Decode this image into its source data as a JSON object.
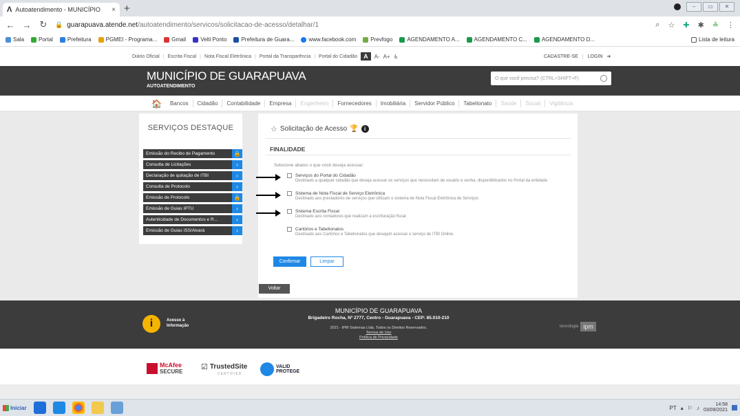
{
  "browser": {
    "tab_title": "Autoatendimento - MUNICÍPIO",
    "tab_close": "×",
    "new_tab": "+",
    "url_host": "guarapuava.atende.net",
    "url_path": "/autoatendimento/servicos/solicitacao-de-acesso/detalhar/1",
    "bookmarks": [
      "Sala",
      "Portal",
      "Prefeitura",
      "PGMEI - Programa...",
      "Gmail",
      "Velti Ponto",
      "Prefeitura de Guara...",
      "www.facebook.com",
      "Prevfogo",
      "AGENDAMENTO A...",
      "AGENDAMENTO C...",
      "AGENDAMENTO D..."
    ],
    "reading_list": "Lista de leitura"
  },
  "topstrip": {
    "links": [
      "Diário Oficial",
      "Escrita Fiscal",
      "Nota Fiscal Eletrônica",
      "Portal da Transparência",
      "Portal do Cidadão"
    ],
    "acc_a": "A",
    "acc_minus": "A-",
    "acc_plus": "A+",
    "register": "CADASTRE-SE",
    "login": "LOGIN"
  },
  "header": {
    "title": "MUNICÍPIO DE GUARAPUAVA",
    "subtitle": "AUTOATENDIMENTO",
    "search_placeholder": "O que você precisa? (CTRL+SHIFT+F)"
  },
  "menu": {
    "items": [
      "Bancos",
      "Cidadão",
      "Contabilidade",
      "Empresa",
      "Engenheiro",
      "Fornecedores",
      "Imobiliária",
      "Servidor Público",
      "Tabelionato",
      "Saúde",
      "Social",
      "Vigilância"
    ]
  },
  "sidebar": {
    "title": "SERVIÇOS DESTAQUE",
    "items": [
      {
        "label": "Emissão do Recibo de Pagamento"
      },
      {
        "label": "Consulta de Licitações"
      },
      {
        "label": "Declaração de quitação de ITBI"
      },
      {
        "label": "Consulta de Protocolo"
      },
      {
        "label": "Emissão de Protocolo"
      },
      {
        "label": "Emissão de Guias IPTU"
      },
      {
        "label": "Autenticidade de Documentos e R..."
      },
      {
        "label": "Emissão de Guias ISS/Alvará"
      }
    ]
  },
  "panel": {
    "title": "Solicitação de Acesso",
    "section": "FINALIDADE",
    "instruction": "Selecione abaixo o que você deseja acessar:",
    "options": [
      {
        "name": "Serviços do Portal do Cidadão",
        "desc": "Destinado a qualquer cidadão que deseja acessar os serviços que necessitam de usuário e senha, disponibilizados no Portal da entidade."
      },
      {
        "name": "Sistema de Nota Fiscal de Serviço Eletrônica",
        "desc": "Destinado aos prestadores de serviços que utilizam o sistema de Nota Fiscal Eletrônica de Serviços"
      },
      {
        "name": "Sistema Escrita Fiscal",
        "desc": "Destinado aos contadores que realizam a escrituração fiscal."
      },
      {
        "name": "Cartórios e Tabelionatos",
        "desc": "Destinado aos Cartórios e Tabelionatos que desejam acessar o serviço de ITBI Online."
      }
    ],
    "confirm": "Confirmar",
    "clear": "Limpar"
  },
  "back": "Voltar",
  "footer": {
    "access_l1": "Acesso à",
    "access_l2": "Informação",
    "name": "MUNICÍPIO DE GUARAPUAVA",
    "address": "Brigadeiro Rocha, Nº 2777, Centro - Guarapuava - CEP: 85.010-210",
    "copyright": "2021 - IPM Sistemas Ltda. Todos os Direitos Reservados.",
    "terms": "Termos de Uso",
    "privacy": "Política de Privacidade",
    "tech": "tecnologia",
    "tech_brand": "ipm"
  },
  "seals": {
    "mcafee_1": "McAfee",
    "mcafee_2": "SECURE",
    "trusted": "TrustedSite",
    "trusted_cert": "CERTIFIED",
    "protege_1": "VALID",
    "protege_2": "PROTEGE"
  },
  "taskbar": {
    "start": "Iniciar",
    "lang": "PT",
    "time": "14:58",
    "date": "03/09/2021"
  }
}
